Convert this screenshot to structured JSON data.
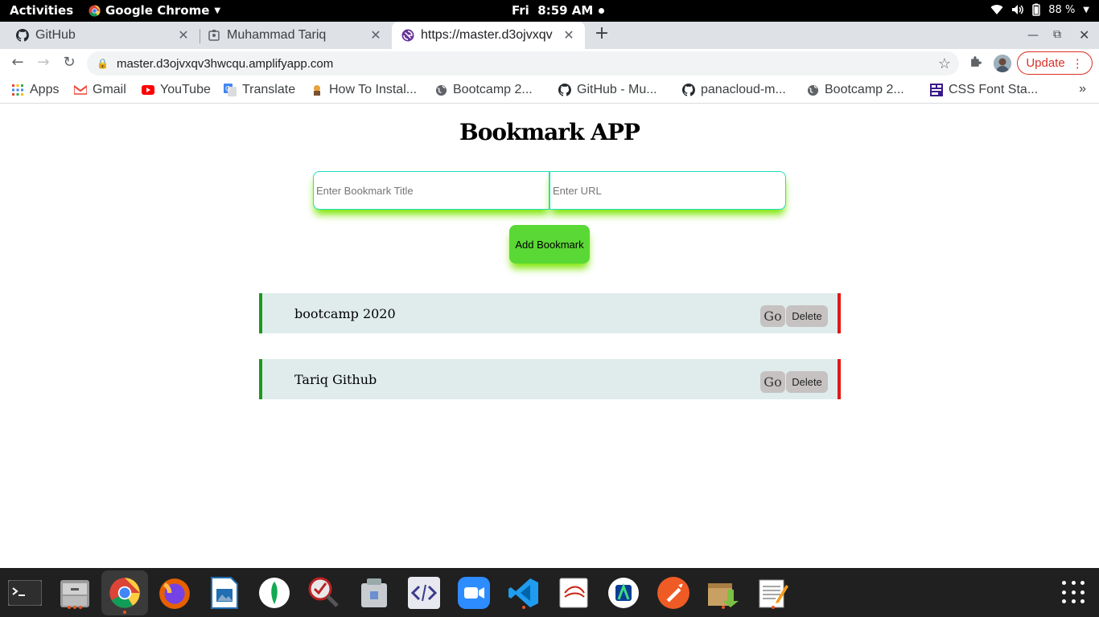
{
  "topbar": {
    "activities": "Activities",
    "app_name": "Google Chrome",
    "clock": "Fri  8:59 AM",
    "battery": "88 %"
  },
  "tabs": [
    {
      "title": "GitHub",
      "icon": "github-icon",
      "active": false
    },
    {
      "title": "Muhammad Tariq",
      "icon": "id-badge-icon",
      "active": false
    },
    {
      "title": "https://master.d3ojvxqv",
      "icon": "gatsby-icon",
      "active": true
    }
  ],
  "omnibox": {
    "url": "master.d3ojvxqv3hwcqu.amplifyapp.com"
  },
  "toolbar": {
    "update_label": "Update"
  },
  "bookmarks": [
    {
      "label": "Apps",
      "icon": "apps-grid-icon"
    },
    {
      "label": "Gmail",
      "icon": "gmail-icon"
    },
    {
      "label": "YouTube",
      "icon": "youtube-icon"
    },
    {
      "label": "Translate",
      "icon": "translate-icon"
    },
    {
      "label": "How To Instal...",
      "icon": "tutorial-icon"
    },
    {
      "label": "Bootcamp 2...",
      "icon": "globe-icon"
    },
    {
      "label": "GitHub - Mu...",
      "icon": "github-icon"
    },
    {
      "label": "panacloud-m...",
      "icon": "github-icon"
    },
    {
      "label": "Bootcamp 2...",
      "icon": "globe-icon"
    },
    {
      "label": "CSS Font Sta...",
      "icon": "css-icon"
    }
  ],
  "app": {
    "title": "Bookmark APP",
    "title_placeholder": "Enter Bookmark Title",
    "url_placeholder": "Enter URL",
    "add_label": "Add Bookmark",
    "items": [
      {
        "title": "bootcamp 2020",
        "go_label": "Go",
        "delete_label": "Delete"
      },
      {
        "title": "Tariq Github",
        "go_label": "Go",
        "delete_label": "Delete"
      }
    ]
  },
  "dock": [
    "terminal-icon",
    "files-icon",
    "chrome-icon",
    "firefox-icon",
    "image-viewer-icon",
    "mongodb-compass-icon",
    "testing-tool-icon",
    "archive-manager-icon",
    "code-editor-icon",
    "zoom-icon",
    "vscode-icon",
    "document-reader-icon",
    "android-studio-icon",
    "postman-icon",
    "package-installer-icon",
    "text-editor-icon"
  ]
}
